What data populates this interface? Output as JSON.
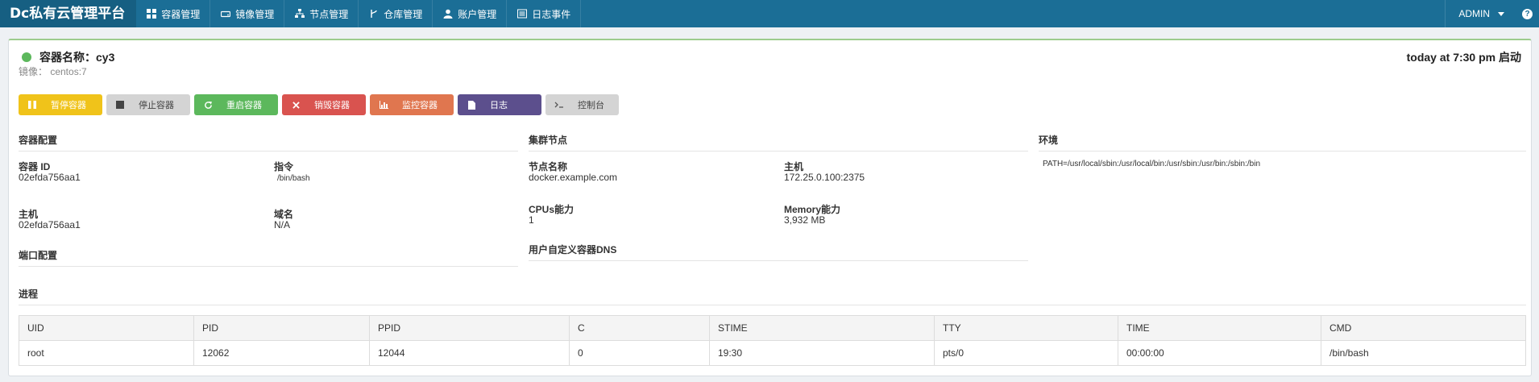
{
  "app": {
    "brand": "Dc私有云管理平台"
  },
  "nav": {
    "items": [
      {
        "label": "容器管理",
        "icon": "grid-icon"
      },
      {
        "label": "镜像管理",
        "icon": "drive-icon"
      },
      {
        "label": "节点管理",
        "icon": "sitemap-icon"
      },
      {
        "label": "仓库管理",
        "icon": "branch-icon"
      },
      {
        "label": "账户管理",
        "icon": "user-icon"
      },
      {
        "label": "日志事件",
        "icon": "list-icon"
      }
    ],
    "user": "ADMIN",
    "help": "?"
  },
  "container": {
    "status_color": "#5cb85c",
    "title": "容器名称：cy3",
    "image_line": "镜像：  centos:7",
    "time_info": "today at 7:30 pm 启动"
  },
  "buttons": {
    "pause": "暂停容器",
    "stop": "停止容器",
    "restart": "重启容器",
    "delete": "销毁容器",
    "monitor": "监控容器",
    "log": "日志",
    "console": "控制台"
  },
  "config": {
    "title": "容器配置",
    "id_label": "容器 ID",
    "id_value": "02efda756aa1",
    "cmd_label": "指令",
    "cmd_value": "/bin/bash",
    "host_label": "主机",
    "host_value": "02efda756aa1",
    "domain_label": "域名",
    "domain_value": "N/A"
  },
  "ports": {
    "title": "端口配置"
  },
  "cluster": {
    "title": "集群节点",
    "node_label": "节点名称",
    "node_value": "docker.example.com",
    "host_label": "主机",
    "host_value": "172.25.0.100:2375",
    "cpu_label": "CPUs能力",
    "cpu_value": "1",
    "mem_label": "Memory能力",
    "mem_value": "3,932 MB"
  },
  "dns": {
    "title": "用户自定义容器DNS"
  },
  "env": {
    "title": "环境",
    "value": "PATH=/usr/local/sbin:/usr/local/bin:/usr/sbin:/usr/bin:/sbin:/bin"
  },
  "process": {
    "title": "进程",
    "headers": [
      "UID",
      "PID",
      "PPID",
      "C",
      "STIME",
      "TTY",
      "TIME",
      "CMD"
    ],
    "rows": [
      [
        "root",
        "12062",
        "12044",
        "0",
        "19:30",
        "pts/0",
        "00:00:00",
        "/bin/bash"
      ]
    ]
  }
}
